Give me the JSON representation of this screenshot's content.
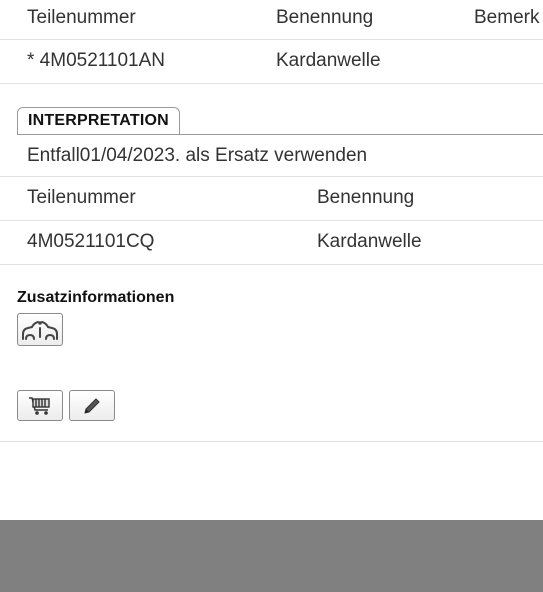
{
  "header_table": {
    "columns": [
      "Teilenummer",
      "Benennung",
      "Bemerk"
    ],
    "row": {
      "part_number": "* 4M0521101AN",
      "name": "Kardanwelle"
    }
  },
  "interpretation": {
    "tab_label": "INTERPRETATION",
    "note": "Entfall01/04/2023. als Ersatz verwenden",
    "columns": [
      "Teilenummer",
      "Benennung"
    ],
    "row": {
      "part_number": "4M0521101CQ",
      "name": "Kardanwelle"
    }
  },
  "additional_info": {
    "title": "Zusatzinformationen",
    "icon": "vehicle-info-icon"
  },
  "actions": {
    "cart_icon": "shopping-cart-icon",
    "edit_icon": "pencil-icon"
  }
}
